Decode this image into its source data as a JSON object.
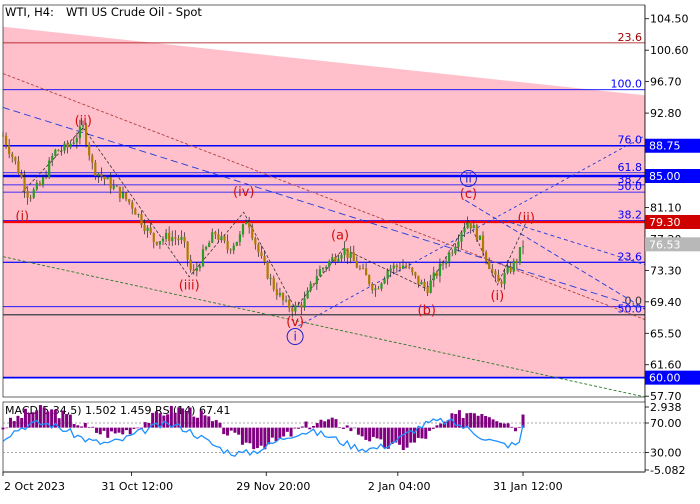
{
  "header": {
    "symbol": "WTI, H4:",
    "name": "WTI US Crude Oil - Spot"
  },
  "colors": {
    "background": "#ffffff",
    "band_fill": "#ffc0cb",
    "fib_line": "#0000ff",
    "level_line": "#ff0000",
    "wave_label": "#d01010",
    "wave_label_blue": "#1e22c8",
    "channel_blue": "#1e3cd8",
    "channel_red": "#b04040",
    "channel_green": "#2a7a2a",
    "candle_up": "#2a9a2a",
    "candle_down": "#b07a00",
    "macd_hist": "#800080",
    "rsi_line": "#1e90ff",
    "axis_text": "#000000"
  },
  "chart_data": [
    {
      "type": "candlestick",
      "title": "WTI US Crude Oil - Spot",
      "timeframe": "H4",
      "ylim": [
        57.6,
        106.2
      ],
      "y_ticks": [
        "104.50",
        "100.60",
        "96.70",
        "92.80",
        "88.90",
        "85.00",
        "81.10",
        "77.20",
        "73.30",
        "69.40",
        "65.50",
        "61.60",
        "57.70"
      ],
      "x_ticks": [
        "2 Oct 2023",
        "31 Oct 12:00",
        "29 Nov 20:00",
        "2 Jan 04:00",
        "31 Jan 12:00"
      ],
      "price_tags": [
        {
          "label": "88.75",
          "value": 88.75,
          "style": "blue"
        },
        {
          "label": "85.00",
          "value": 85.0,
          "style": "blue"
        },
        {
          "label": "79.30",
          "value": 79.3,
          "style": "red"
        },
        {
          "label": "76.53",
          "value": 76.53,
          "style": "current"
        },
        {
          "label": "60.00",
          "value": 60.0,
          "style": "blue"
        }
      ],
      "fib_levels": [
        {
          "label": "23.6",
          "value": 101.5
        },
        {
          "label": "100.0",
          "value": 95.7
        },
        {
          "label": "76.0",
          "value": 88.75
        },
        {
          "label": "61.8",
          "value": 85.4
        },
        {
          "label": "50.0",
          "value": 83.0
        },
        {
          "label": "38.2",
          "value": 83.9
        },
        {
          "label": "38.2",
          "value": 79.5
        },
        {
          "label": "23.6",
          "value": 74.3
        },
        {
          "label": "0.0",
          "value": 68.8
        },
        {
          "label": "50.0",
          "value": 67.8
        }
      ],
      "wave_labels": [
        {
          "text": "(i)",
          "x": 0.03,
          "y": 79.5,
          "style": "red"
        },
        {
          "text": "(ii)",
          "x": 0.125,
          "y": 91.3,
          "style": "red"
        },
        {
          "text": "(iii)",
          "x": 0.29,
          "y": 70.9,
          "style": "red"
        },
        {
          "text": "(iv)",
          "x": 0.375,
          "y": 82.5,
          "style": "red"
        },
        {
          "text": "(v)",
          "x": 0.455,
          "y": 66.4,
          "style": "red"
        },
        {
          "text": "i",
          "x": 0.455,
          "y": 64.6,
          "style": "blue-circle"
        },
        {
          "text": "(a)",
          "x": 0.525,
          "y": 77.1,
          "style": "red"
        },
        {
          "text": "(b)",
          "x": 0.66,
          "y": 67.8,
          "style": "red"
        },
        {
          "text": "(c)",
          "x": 0.725,
          "y": 82.3,
          "style": "red"
        },
        {
          "text": "ii",
          "x": 0.725,
          "y": 84.2,
          "style": "blue-circle"
        },
        {
          "text": "(i)",
          "x": 0.77,
          "y": 69.6,
          "style": "red"
        },
        {
          "text": "(ii)",
          "x": 0.815,
          "y": 79.3,
          "style": "red"
        }
      ],
      "candle_path": [
        [
          0,
          90
        ],
        [
          0.02,
          86.5
        ],
        [
          0.04,
          82.5
        ],
        [
          0.06,
          84
        ],
        [
          0.08,
          88
        ],
        [
          0.1,
          88.5
        ],
        [
          0.125,
          91
        ],
        [
          0.14,
          86
        ],
        [
          0.16,
          84.5
        ],
        [
          0.2,
          81.5
        ],
        [
          0.235,
          77
        ],
        [
          0.26,
          77.5
        ],
        [
          0.28,
          77
        ],
        [
          0.295,
          72.5
        ],
        [
          0.31,
          75
        ],
        [
          0.33,
          78
        ],
        [
          0.35,
          76
        ],
        [
          0.37,
          77.5
        ],
        [
          0.38,
          80
        ],
        [
          0.4,
          75
        ],
        [
          0.42,
          71.5
        ],
        [
          0.44,
          69
        ],
        [
          0.455,
          68.6
        ],
        [
          0.47,
          69.5
        ],
        [
          0.49,
          73
        ],
        [
          0.51,
          74.5
        ],
        [
          0.53,
          76
        ],
        [
          0.555,
          73.5
        ],
        [
          0.58,
          71
        ],
        [
          0.6,
          73.5
        ],
        [
          0.625,
          74
        ],
        [
          0.645,
          72
        ],
        [
          0.66,
          71
        ],
        [
          0.68,
          73.5
        ],
        [
          0.7,
          76
        ],
        [
          0.715,
          78.5
        ],
        [
          0.725,
          79.5
        ],
        [
          0.74,
          77.5
        ],
        [
          0.755,
          74.5
        ],
        [
          0.77,
          71.5
        ],
        [
          0.785,
          73
        ],
        [
          0.8,
          74.5
        ],
        [
          0.81,
          76.53
        ]
      ]
    },
    {
      "type": "bar",
      "title": "MACD(5,34,5) 1.502 1.459 RSI(14) 67.41",
      "ylim": [
        -5.082,
        2.938
      ],
      "y_ticks": [
        "2.938",
        "70.00",
        "30.00",
        "-5.082"
      ],
      "macd_value": 1.502,
      "signal_value": 1.459,
      "rsi_value": 67.41
    }
  ]
}
